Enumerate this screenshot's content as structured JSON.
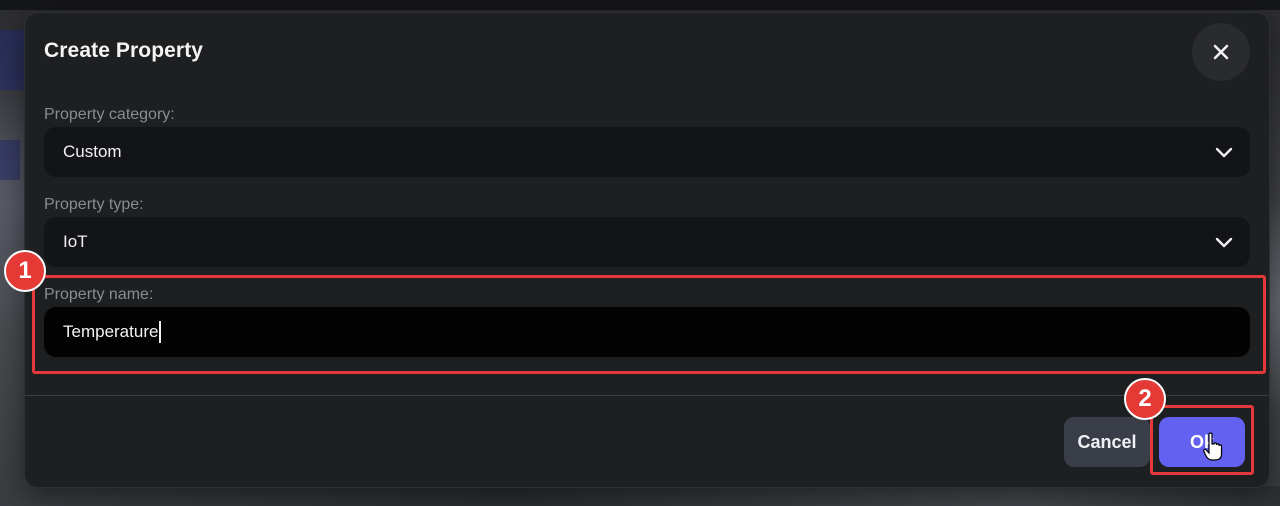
{
  "dialog": {
    "title": "Create Property",
    "close_icon": "close-icon"
  },
  "fields": {
    "category": {
      "label": "Property category:",
      "value": "Custom"
    },
    "type": {
      "label": "Property type:",
      "value": "IoT"
    },
    "name": {
      "label": "Property name:",
      "value": "Temperature"
    }
  },
  "buttons": {
    "cancel_label": "Cancel",
    "ok_label": "Ok"
  },
  "annotations": {
    "step1": "1",
    "step2": "2",
    "highlight_color": "#e5383b"
  },
  "colors": {
    "accent": "#6361f0",
    "dialog_bg": "#1e1f21",
    "field_bg": "#131416"
  }
}
